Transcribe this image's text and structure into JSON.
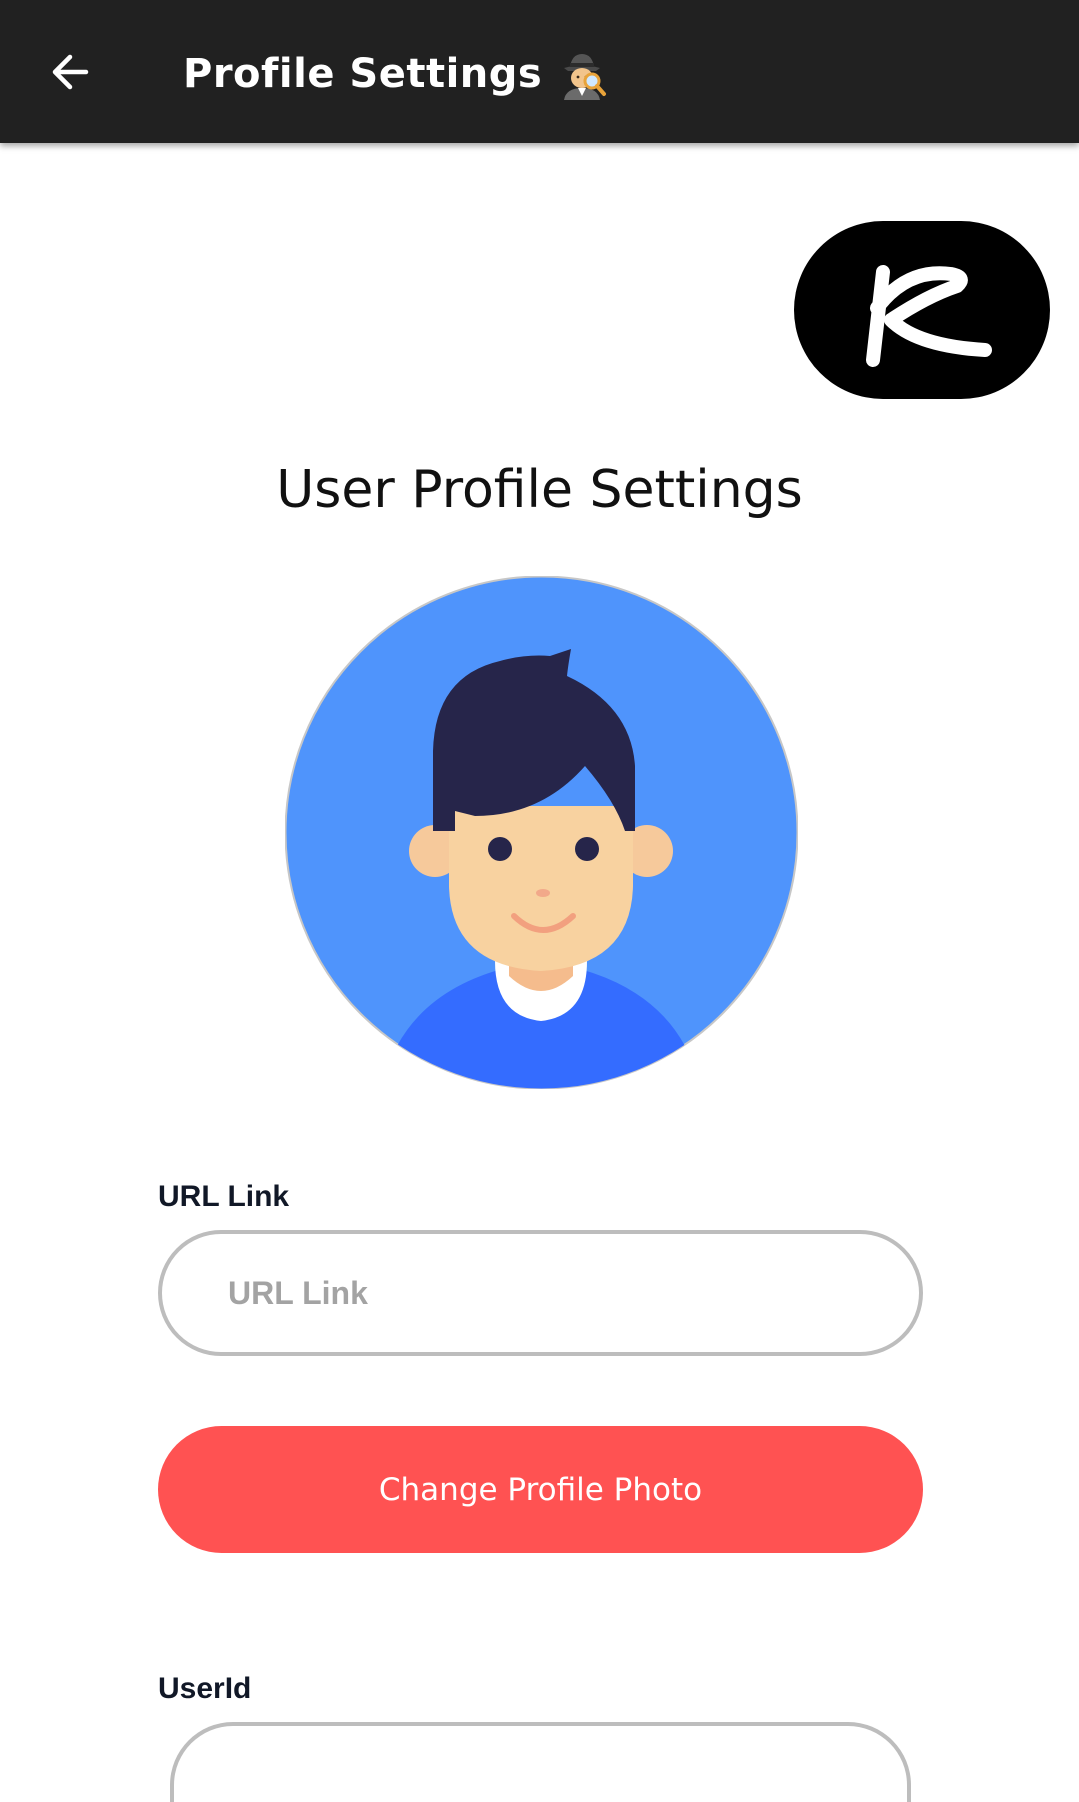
{
  "app_bar": {
    "title": "Profile Settings",
    "title_emoji_icon": "detective-icon",
    "back_icon": "arrow-left-icon",
    "background_color": "#212121"
  },
  "brand_logo": {
    "icon": "rc-logo-icon"
  },
  "page": {
    "heading": "User Profile Settings"
  },
  "avatar": {
    "icon": "user-avatar-icon",
    "background_color": "#4f94fc"
  },
  "url_field": {
    "label": "URL Link",
    "placeholder": "URL Link",
    "value": ""
  },
  "change_photo_button": {
    "label": "Change Profile Photo",
    "color": "#ff5252"
  },
  "userid_field": {
    "label": "UserId"
  }
}
